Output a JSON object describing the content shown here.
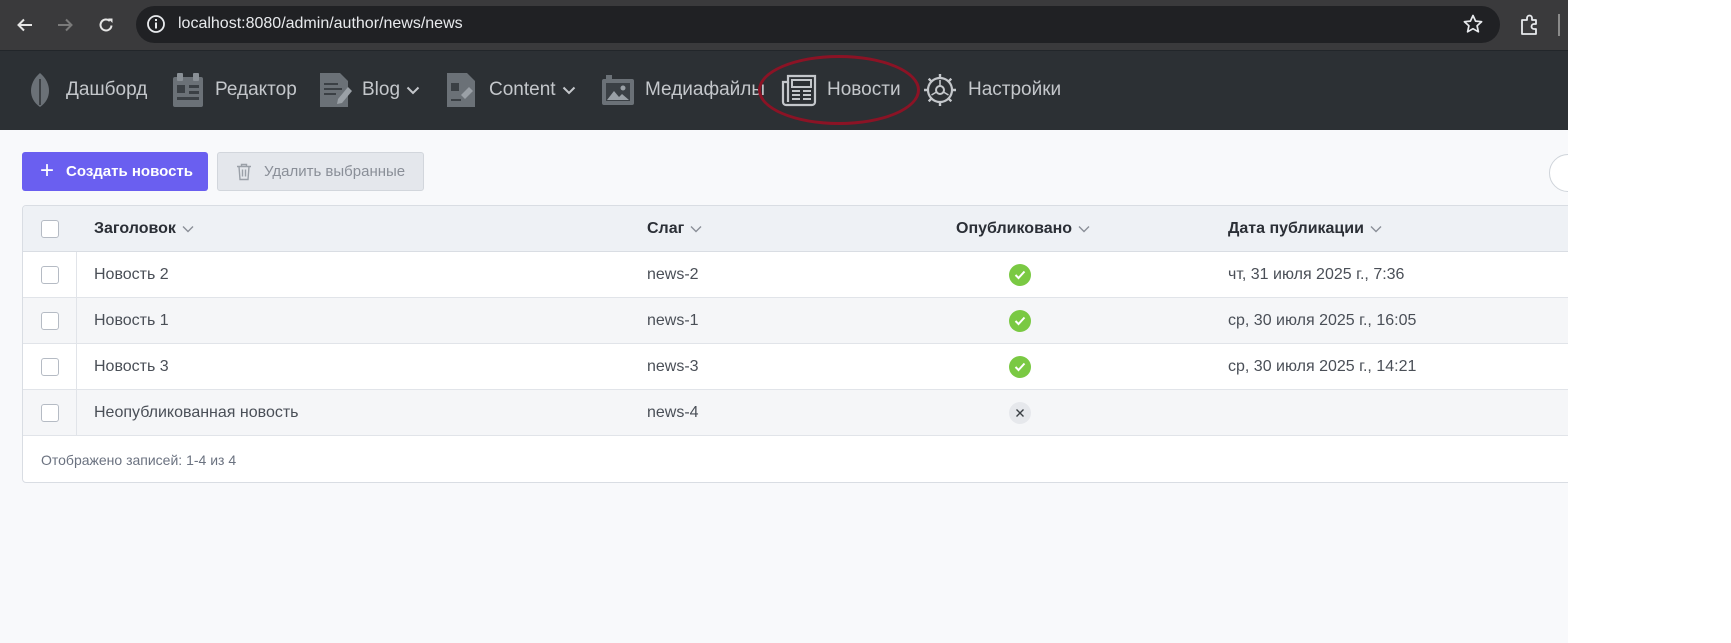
{
  "browser": {
    "url": "localhost:8080/admin/author/news/news"
  },
  "nav": {
    "items": [
      {
        "label": "Дашборд"
      },
      {
        "label": "Редактор"
      },
      {
        "label": "Blog"
      },
      {
        "label": "Content"
      },
      {
        "label": "Медиафайлы"
      },
      {
        "label": "Новости"
      },
      {
        "label": "Настройки"
      }
    ],
    "active": "Новости"
  },
  "toolbar": {
    "create_label": "Создать новость",
    "delete_label": "Удалить выбранные"
  },
  "table": {
    "columns": [
      "Заголовок",
      "Слаг",
      "Опубликовано",
      "Дата публикации"
    ],
    "rows": [
      {
        "title": "Новость 2",
        "slug": "news-2",
        "published": true,
        "date": "чт, 31 июля 2025 г., 7:36"
      },
      {
        "title": "Новость 1",
        "slug": "news-1",
        "published": true,
        "date": "ср, 30 июля 2025 г., 16:05"
      },
      {
        "title": "Новость 3",
        "slug": "news-3",
        "published": true,
        "date": "ср, 30 июля 2025 г., 14:21"
      },
      {
        "title": "Неопубликованная новость",
        "slug": "news-4",
        "published": false,
        "date": ""
      }
    ],
    "footer": "Отображено записей: 1-4 из 4"
  },
  "colors": {
    "primary": "#6a5ff0",
    "header_bg": "#2c3034",
    "published_ok": "#7ac943",
    "highlight": "#8b1325"
  }
}
